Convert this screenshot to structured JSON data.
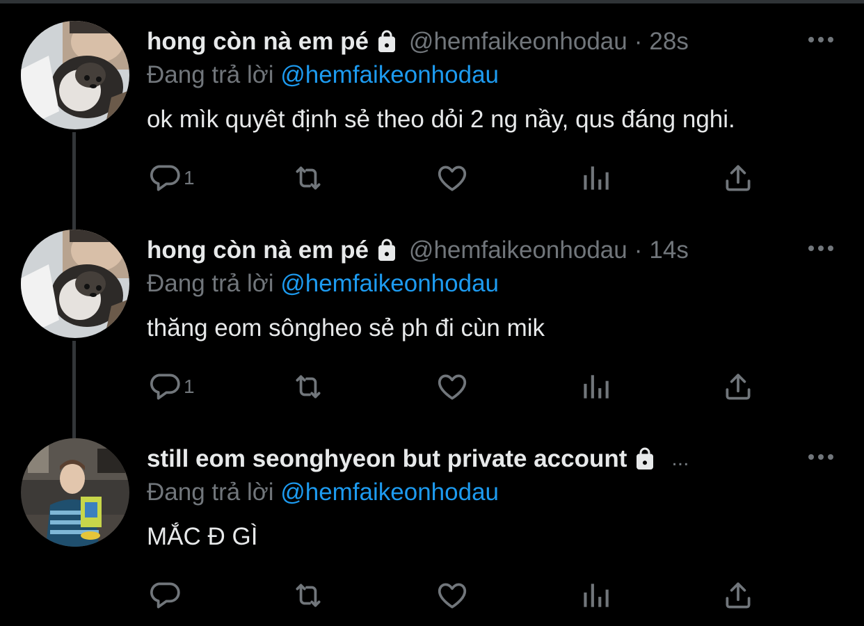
{
  "colors": {
    "background": "#000000",
    "text": "#e7e9ea",
    "muted": "#71767b",
    "accent": "#1d9bf0",
    "thread_line": "#333639"
  },
  "tweets": [
    {
      "display_name": "hong còn nà em pé",
      "lock_icon": "lock-icon",
      "handle": "@hemfaikeonhodau",
      "separator": "·",
      "time": "28s",
      "more_icon": "more-horizontal-icon",
      "replying_prefix": "Đang trả lời",
      "replying_to": "@hemfaikeonhodau",
      "text": "ok mìk quyêt định sẻ theo dỏi 2 ng nầy, qus đáng nghi.",
      "actions": {
        "reply_icon": "reply-icon",
        "reply_count": "1",
        "retweet_icon": "retweet-icon",
        "like_icon": "heart-icon",
        "views_icon": "analytics-icon",
        "share_icon": "share-icon"
      }
    },
    {
      "display_name": "hong còn nà em pé",
      "lock_icon": "lock-icon",
      "handle": "@hemfaikeonhodau",
      "separator": "·",
      "time": "14s",
      "more_icon": "more-horizontal-icon",
      "replying_prefix": "Đang trả lời",
      "replying_to": "@hemfaikeonhodau",
      "text": "thăng eom sônghеo sẻ ph đi cùn mik",
      "actions": {
        "reply_icon": "reply-icon",
        "reply_count": "1",
        "retweet_icon": "retweet-icon",
        "like_icon": "heart-icon",
        "views_icon": "analytics-icon",
        "share_icon": "share-icon"
      }
    },
    {
      "display_name": "still eom seonghyeon but private account",
      "lock_icon": "lock-icon",
      "truncation": "...",
      "more_icon": "more-horizontal-icon",
      "replying_prefix": "Đang trả lời",
      "replying_to": "@hemfaikeonhodau",
      "text": "MẮC Đ GÌ",
      "actions": {
        "reply_icon": "reply-icon",
        "retweet_icon": "retweet-icon",
        "like_icon": "heart-icon",
        "views_icon": "analytics-icon",
        "share_icon": "share-icon"
      }
    }
  ]
}
